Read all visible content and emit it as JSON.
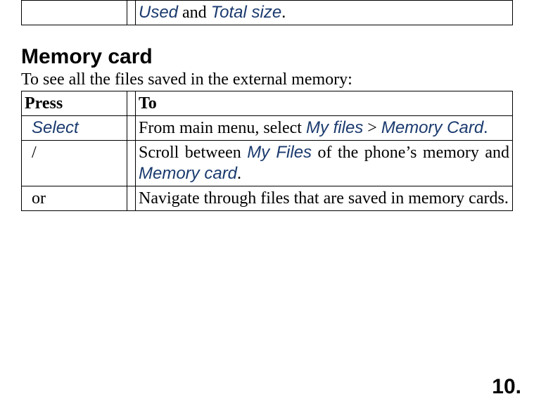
{
  "top_table": {
    "row": {
      "press": "",
      "gap": "",
      "to_parts": {
        "used": "Used",
        "and": " and ",
        "total_size": "Total size",
        "dot": "."
      }
    }
  },
  "heading": "Memory card",
  "intro": "To see all the files saved in the external memory:",
  "main_table": {
    "header": {
      "press": "Press",
      "gap": "",
      "to": "To"
    },
    "rows": [
      {
        "press_key": "Select",
        "to_parts": {
          "t1": "From main menu, select ",
          "my_files": "My files",
          "gt": " > ",
          "memory_card": "Memory Card",
          "dot": "."
        }
      },
      {
        "press_plain": " /",
        "to_parts": {
          "t1": "Scroll between ",
          "my_files": "My Files",
          "t2": " of the phone’s memory and ",
          "memory_card": "Memory card",
          "dot": "."
        }
      },
      {
        "press_plain": " or",
        "to_plain": "Navigate through files that are saved in memory cards."
      }
    ]
  },
  "page_number": "10."
}
